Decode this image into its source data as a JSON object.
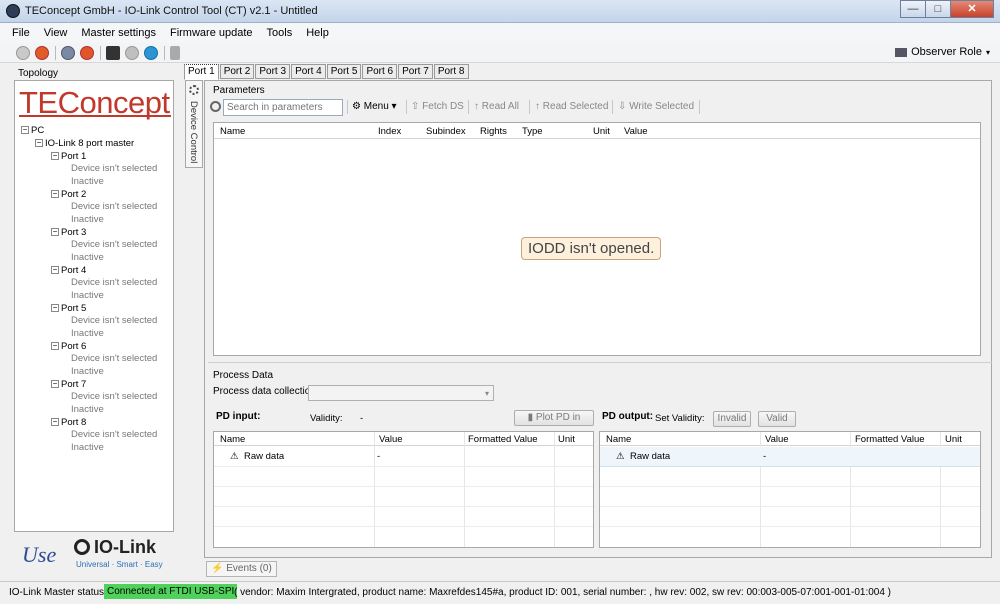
{
  "window": {
    "title": "TEConcept GmbH - IO-Link Control Tool (CT) v2.1 - Untitled",
    "min": "—",
    "max": "□",
    "close": "✕"
  },
  "menu": [
    "File",
    "View",
    "Master settings",
    "Firmware update",
    "Tools",
    "Help"
  ],
  "toolbar": {
    "role": "Observer Role"
  },
  "topology": {
    "label": "Topology",
    "logo": "TEConcept",
    "root": "PC",
    "master": "IO-Link 8 port master",
    "ports": [
      {
        "name": "Port 1",
        "device": "Device isn't selected",
        "state": "Inactive"
      },
      {
        "name": "Port 2",
        "device": "Device isn't selected",
        "state": "Inactive"
      },
      {
        "name": "Port 3",
        "device": "Device isn't selected",
        "state": "Inactive"
      },
      {
        "name": "Port 4",
        "device": "Device isn't selected",
        "state": "Inactive"
      },
      {
        "name": "Port 5",
        "device": "Device isn't selected",
        "state": "Inactive"
      },
      {
        "name": "Port 6",
        "device": "Device isn't selected",
        "state": "Inactive"
      },
      {
        "name": "Port 7",
        "device": "Device isn't selected",
        "state": "Inactive"
      },
      {
        "name": "Port 8",
        "device": "Device isn't selected",
        "state": "Inactive"
      }
    ]
  },
  "brand": {
    "use": "Use",
    "iolink": "IO-Link",
    "tagline": "Universal · Smart · Easy"
  },
  "tabs": [
    "Port 1",
    "Port 2",
    "Port 3",
    "Port 4",
    "Port 5",
    "Port 6",
    "Port 7",
    "Port 8"
  ],
  "device_control": "Device Control",
  "parameters": {
    "label": "Parameters",
    "search_placeholder": "Search in parameters",
    "menu": "Menu",
    "fetch": "Fetch DS",
    "read_all": "Read All",
    "read_selected": "Read Selected",
    "write_selected": "Write Selected",
    "columns": [
      "Name",
      "Index",
      "Subindex",
      "Rights",
      "Type",
      "Unit",
      "Value"
    ],
    "empty_message": "IODD isn't opened."
  },
  "process": {
    "label": "Process Data",
    "collection_label": "Process data collection:",
    "pd_input": "PD input:",
    "validity_label": "Validity:",
    "validity_value": "-",
    "plot": "Plot PD in",
    "pd_output": "PD output:",
    "set_validity": "Set Validity:",
    "invalid": "Invalid",
    "valid": "Valid",
    "columns": [
      "Name",
      "Value",
      "Formatted Value",
      "Unit"
    ],
    "input_row": {
      "name": "Raw data",
      "value": "-"
    },
    "output_row": {
      "name": "Raw data",
      "value": "-"
    }
  },
  "events": "Events (0)",
  "status": {
    "label": "IO-Link Master status:",
    "connection": "Connected at FTDI USB-SPI",
    "info": "( vendor: Maxim Intergrated, product name: Maxrefdes145#a, product ID: 001, serial number: , hw rev: 002, sw rev: 00:003-005-07:001-001-01:004 )"
  },
  "colors": {
    "accent_red": "#c0392b",
    "connected": "#4fd25b"
  }
}
